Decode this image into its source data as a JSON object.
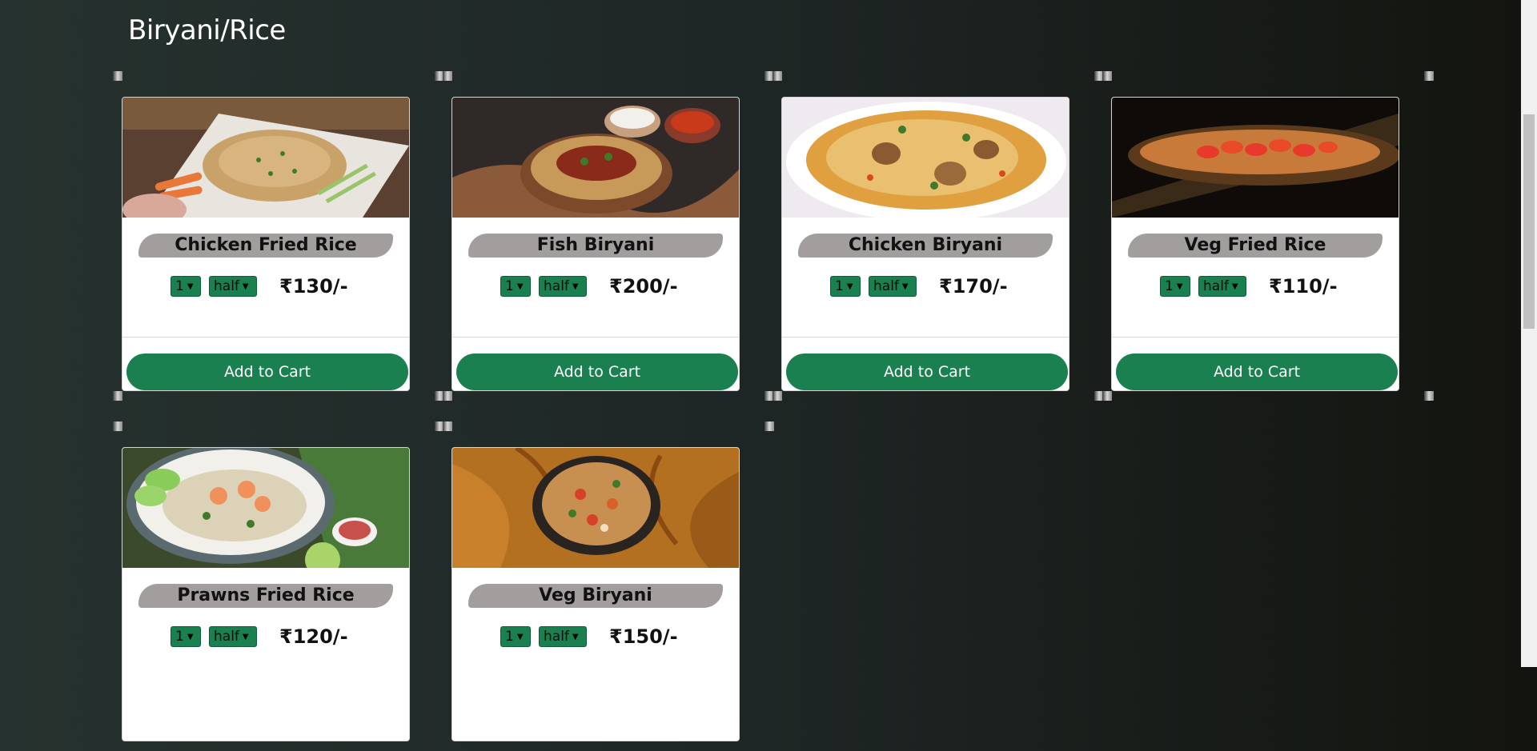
{
  "section": {
    "title": "Biryani/Rice"
  },
  "cart_label": "Add to Cart",
  "items": [
    {
      "name": "Chicken Fried Rice",
      "qty": "1",
      "size": "half",
      "price": "₹130/-"
    },
    {
      "name": "Fish Biryani",
      "qty": "1",
      "size": "half",
      "price": "₹200/-"
    },
    {
      "name": "Chicken Biryani",
      "qty": "1",
      "size": "half",
      "price": "₹170/-"
    },
    {
      "name": "Veg Fried Rice",
      "qty": "1",
      "size": "half",
      "price": "₹110/-"
    },
    {
      "name": "Prawns Fried Rice",
      "qty": "1",
      "size": "half",
      "price": "₹120/-"
    },
    {
      "name": "Veg Biryani",
      "qty": "1",
      "size": "half",
      "price": "₹150/-"
    }
  ],
  "icons": {
    "dropdown": "chevron-down-icon"
  },
  "colors": {
    "accent": "#1b8050",
    "name_pill": "#a39e9e",
    "card": "#ffffff"
  }
}
